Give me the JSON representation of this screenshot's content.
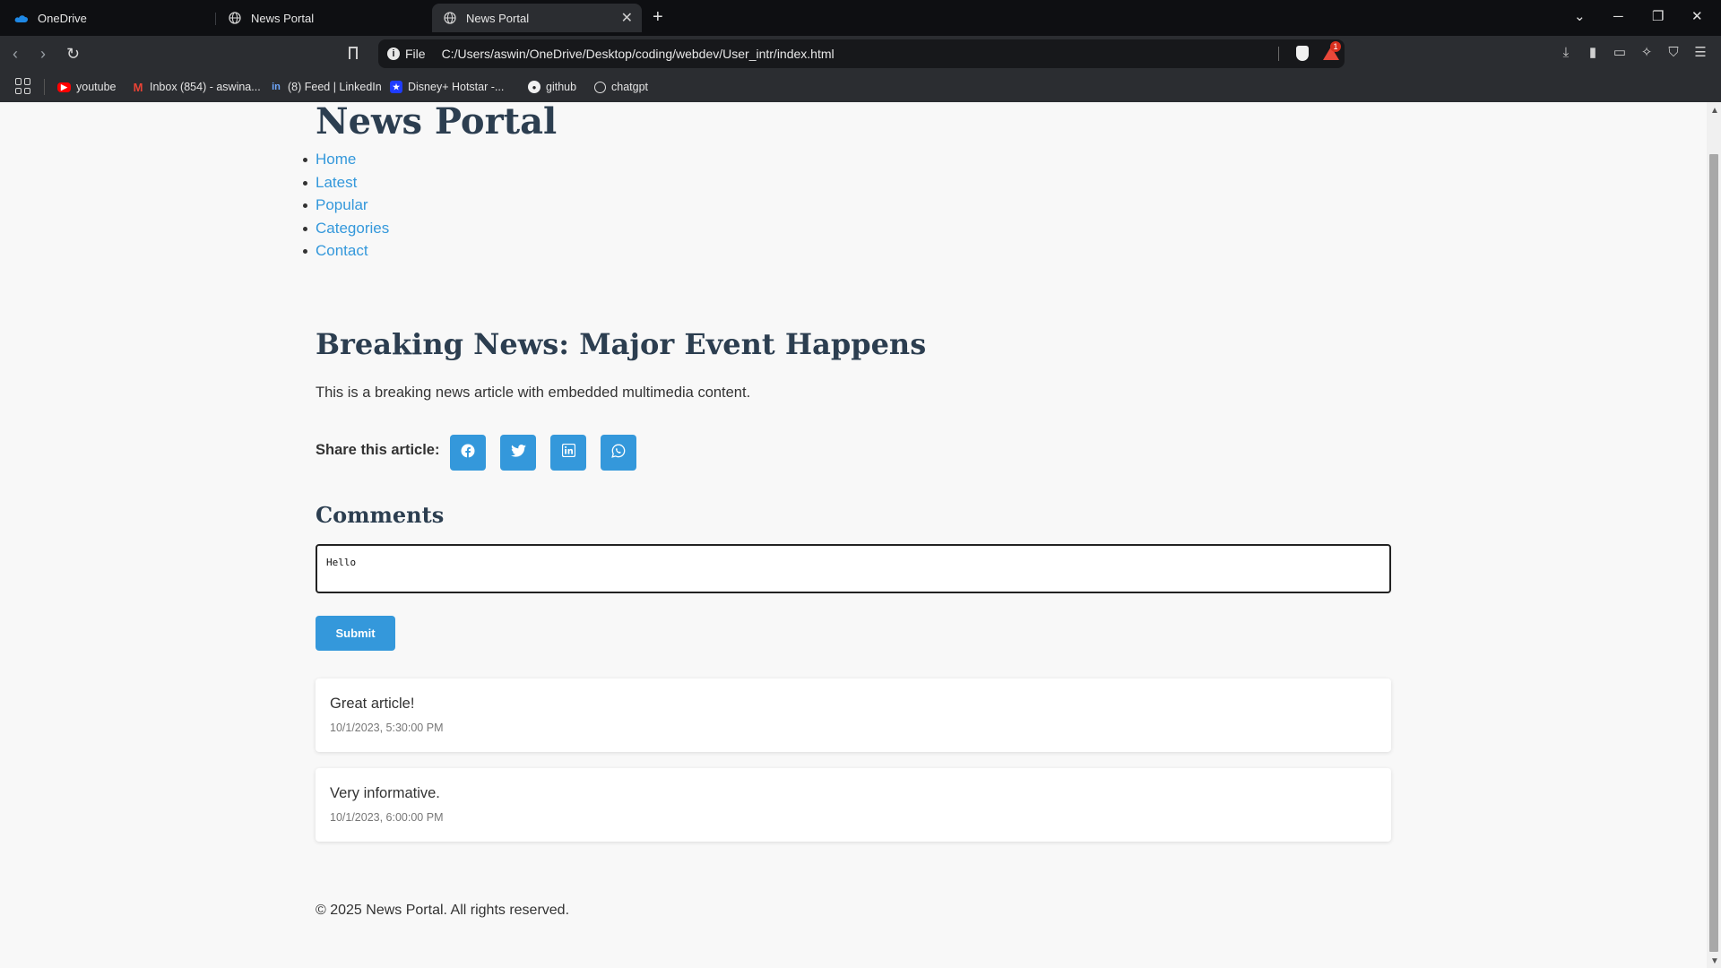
{
  "browser": {
    "tabs": [
      {
        "title": "OneDrive",
        "icon": "onedrive-icon",
        "active": false
      },
      {
        "title": "News Portal",
        "icon": "globe-icon",
        "active": false
      },
      {
        "title": "News Portal",
        "icon": "globe-icon",
        "active": true
      }
    ],
    "address": {
      "scheme_label": "File",
      "url": "C:/Users/aswin/OneDrive/Desktop/coding/webdev/User_intr/index.html"
    },
    "rewards_badge": "1",
    "bookmarks": [
      {
        "label": "youtube",
        "icon": "youtube-icon",
        "color": "#ff0000"
      },
      {
        "label": "Inbox (854) - aswina...",
        "icon": "gmail-icon",
        "color": "#ea4335"
      },
      {
        "label": "(8) Feed | LinkedIn",
        "icon": "linkedin-icon",
        "color": "#0a66c2"
      },
      {
        "label": "Disney+ Hotstar -...",
        "icon": "hotstar-icon",
        "color": "#1f3cff"
      },
      {
        "label": "github",
        "icon": "github-icon",
        "color": "#ffffff"
      },
      {
        "label": "chatgpt",
        "icon": "chatgpt-icon",
        "color": "#ffffff"
      }
    ]
  },
  "site": {
    "title": "News Portal",
    "nav": [
      "Home",
      "Latest",
      "Popular",
      "Categories",
      "Contact"
    ],
    "accent_color": "#3498db",
    "heading_color": "#2c3e50"
  },
  "article": {
    "title": "Breaking News: Major Event Happens",
    "body": "This is a breaking news article with embedded multimedia content.",
    "share_label": "Share this article:",
    "share_buttons": [
      "facebook-icon",
      "twitter-icon",
      "linkedin-icon",
      "whatsapp-icon"
    ]
  },
  "comments": {
    "title": "Comments",
    "input_value": "Hello",
    "submit_label": "Submit",
    "items": [
      {
        "text": "Great article!",
        "timestamp": "10/1/2023, 5:30:00 PM"
      },
      {
        "text": "Very informative.",
        "timestamp": "10/1/2023, 6:00:00 PM"
      }
    ]
  },
  "footer": {
    "text": "© 2025 News Portal. All rights reserved."
  }
}
